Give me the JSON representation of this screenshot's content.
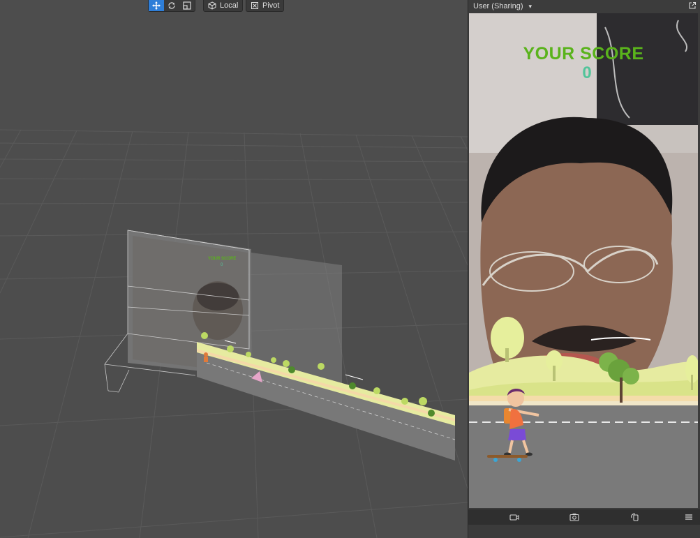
{
  "toolbar": {
    "transform_tools": [
      "move",
      "rotate",
      "scale"
    ],
    "space_label": "Local",
    "pivot_label": "Pivot"
  },
  "panel": {
    "title": "User (Sharing)",
    "popout_icon": "external-link-icon",
    "footer_icons": [
      "camera-icon",
      "snapshot-icon",
      "rotate-device-icon",
      "menu-icon"
    ]
  },
  "preview": {
    "score_title": "YOUR SCORE",
    "score_value": "0",
    "colors": {
      "score_title": "#5ab31c",
      "score_value": "#53c49a",
      "road": "#7a7a7a",
      "hills": "#e6eba0",
      "sky": "#c9c4c0"
    }
  },
  "scene": {
    "mini_score_title": "YOUR SCORE",
    "mini_score_value": "0"
  }
}
